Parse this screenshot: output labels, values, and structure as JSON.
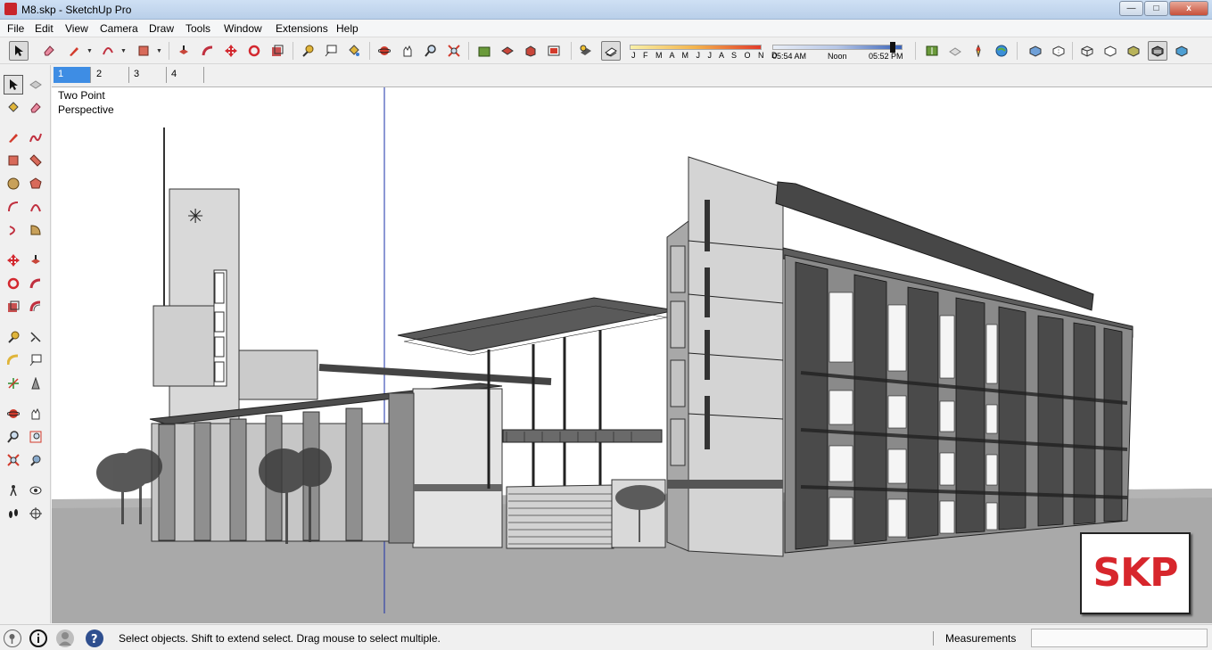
{
  "window": {
    "title": "M8.skp - SketchUp Pro",
    "minimize_glyph": "—",
    "maximize_glyph": "□",
    "close_glyph": "x"
  },
  "menu": [
    "File",
    "Edit",
    "View",
    "Camera",
    "Draw",
    "Tools",
    "Window",
    "Extensions",
    "Help"
  ],
  "shadows": {
    "months_label": "J F M A M J J A S O N D",
    "time_start": "05:54 AM",
    "time_mid": "Noon",
    "time_end": "05:52 PM",
    "month_accent": "#e23b2b",
    "time_accent": "#3a63b8"
  },
  "scene_tabs": [
    {
      "label": "1",
      "active": true
    },
    {
      "label": "2",
      "active": false
    },
    {
      "label": "3",
      "active": false
    },
    {
      "label": "4",
      "active": false
    }
  ],
  "viewport": {
    "camera_line1": "Two Point",
    "camera_line2": "Perspective"
  },
  "status": {
    "message": "Select objects. Shift to extend select. Drag mouse to select multiple.",
    "measurements_label": "Measurements",
    "measurements_value": ""
  },
  "watermark": {
    "text": "SKP",
    "color": "#d7262c"
  },
  "toolbar_icons": [
    "select-icon",
    "eraser-icon",
    "pencil-icon",
    "arc-icon",
    "rectangle-icon",
    "push-pull-icon",
    "follow-me-icon",
    "move-icon",
    "rotate-icon",
    "scale-icon",
    "tape-measure-icon",
    "text-icon",
    "paint-bucket-icon",
    "orbit-icon",
    "pan-icon",
    "zoom-icon",
    "zoom-extents-icon",
    "warehouse-icon",
    "components-icon",
    "extension-icon",
    "add-location-icon",
    "shadows-toggle-icon",
    "fog-icon",
    "geolocation-icon",
    "photo-textures-icon",
    "sandbox-icon",
    "globe-icon",
    "xray-icon",
    "back-edges-icon",
    "wireframe-icon",
    "hidden-line-icon",
    "shaded-icon",
    "monochrome-icon",
    "textures-icon"
  ],
  "left_tool_icons": [
    "select-icon",
    "component-icon",
    "paint-bucket-icon",
    "eraser-icon",
    "line-icon",
    "freehand-icon",
    "rectangle-icon",
    "rotated-rectangle-icon",
    "circle-icon",
    "polygon-icon",
    "arc-icon",
    "two-point-arc-icon",
    "three-point-arc-icon",
    "pie-icon",
    "move-icon",
    "push-pull-icon",
    "rotate-icon",
    "follow-me-icon",
    "scale-icon",
    "offset-icon",
    "tape-measure-icon",
    "dimension-icon",
    "protractor-icon",
    "text-icon",
    "axes-icon",
    "3d-text-icon",
    "orbit-icon",
    "pan-icon",
    "zoom-icon",
    "zoom-window-icon",
    "zoom-extents-icon",
    "previous-view-icon",
    "position-camera-icon",
    "look-around-icon",
    "walk-icon",
    "section-plane-icon"
  ]
}
